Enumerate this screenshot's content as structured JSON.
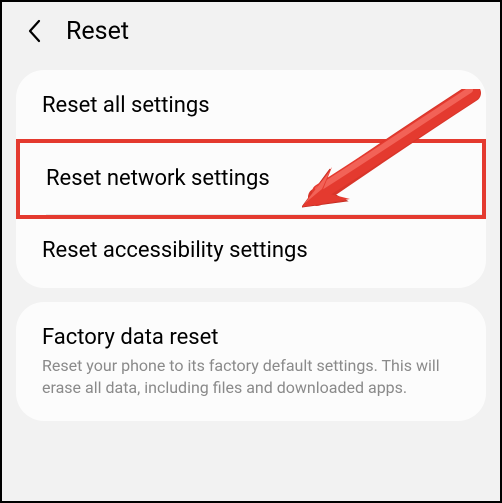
{
  "header": {
    "title": "Reset"
  },
  "card1": {
    "items": [
      {
        "title": "Reset all settings"
      },
      {
        "title": "Reset network settings"
      },
      {
        "title": "Reset accessibility settings"
      }
    ]
  },
  "card2": {
    "items": [
      {
        "title": "Factory data reset",
        "subtitle": "Reset your phone to its factory default settings. This will erase all data, including files and downloaded apps."
      }
    ]
  },
  "annotation": {
    "arrow_color": "#e43a2f",
    "highlight_color": "#e43a2f"
  }
}
